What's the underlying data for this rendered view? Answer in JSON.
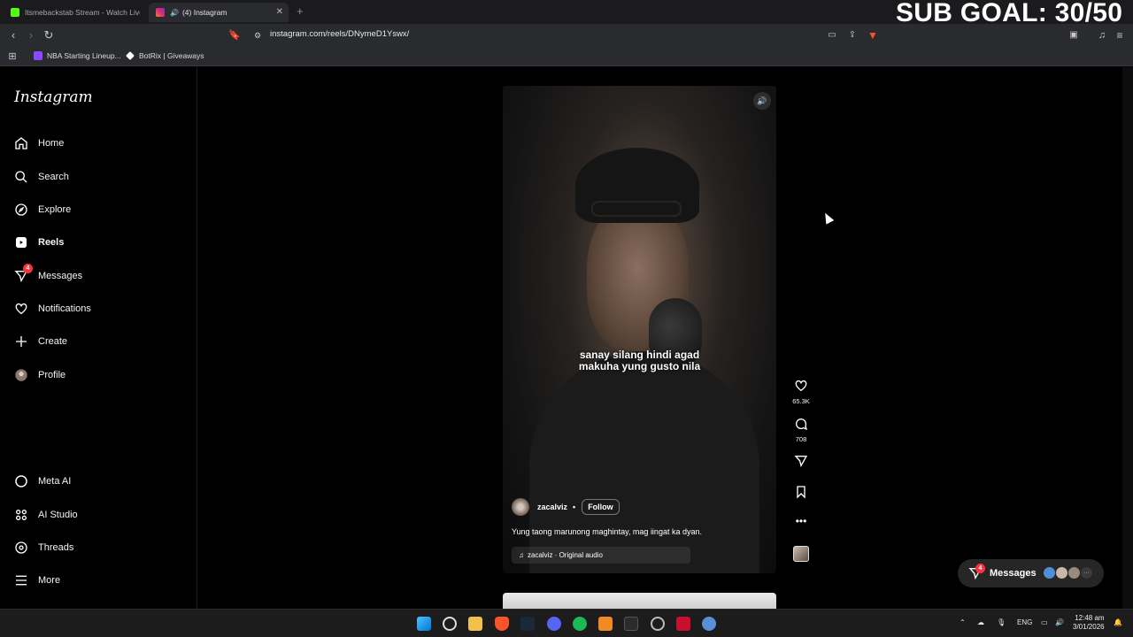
{
  "browser": {
    "tabs": [
      {
        "title": "Itsmebackstab Stream - Watch Live o",
        "active": false,
        "favicon_color": "#53fc18"
      },
      {
        "title": "(4) Instagram",
        "active": true,
        "favicon_color": "#e1306c"
      }
    ],
    "new_tab_label": "+",
    "url": "instagram.com/reels/DNymeD1Yswx/",
    "bookmarks": [
      {
        "label": "NBA Starting Lineup...",
        "icon_color": "#8a4bff"
      },
      {
        "label": "BotRix | Giveaways",
        "icon_color": "#ffffff"
      }
    ]
  },
  "overlay": {
    "sub_goal": "SUB GOAL: 30/50"
  },
  "instagram": {
    "logo": "Instagram",
    "nav": [
      {
        "label": "Home",
        "icon": "home-icon"
      },
      {
        "label": "Search",
        "icon": "search-icon"
      },
      {
        "label": "Explore",
        "icon": "explore-icon"
      },
      {
        "label": "Reels",
        "icon": "reels-icon",
        "active": true
      },
      {
        "label": "Messages",
        "icon": "messages-icon",
        "badge": "4"
      },
      {
        "label": "Notifications",
        "icon": "heart-icon"
      },
      {
        "label": "Create",
        "icon": "plus-icon"
      },
      {
        "label": "Profile",
        "icon": "avatar"
      }
    ],
    "nav_bottom": [
      {
        "label": "Meta AI",
        "icon": "meta-ai-icon"
      },
      {
        "label": "AI Studio",
        "icon": "ai-studio-icon"
      },
      {
        "label": "Threads",
        "icon": "threads-icon"
      },
      {
        "label": "More",
        "icon": "menu-icon"
      }
    ],
    "reel": {
      "caption_overlay_line1": "sanay silang hindi agad",
      "caption_overlay_line2": "makuha yung gusto nila",
      "author": "zacalviz",
      "separator": "•",
      "follow_label": "Follow",
      "description": "Yung taong marunong maghintay, mag iingat ka dyan.",
      "audio": "zacalviz · Original audio",
      "likes": "65.3K",
      "comments": "708"
    },
    "messages_pill": {
      "label": "Messages",
      "badge": "4"
    }
  },
  "taskbar": {
    "language": "ENG",
    "time": "12:48 am",
    "date": "3/01/2026"
  }
}
